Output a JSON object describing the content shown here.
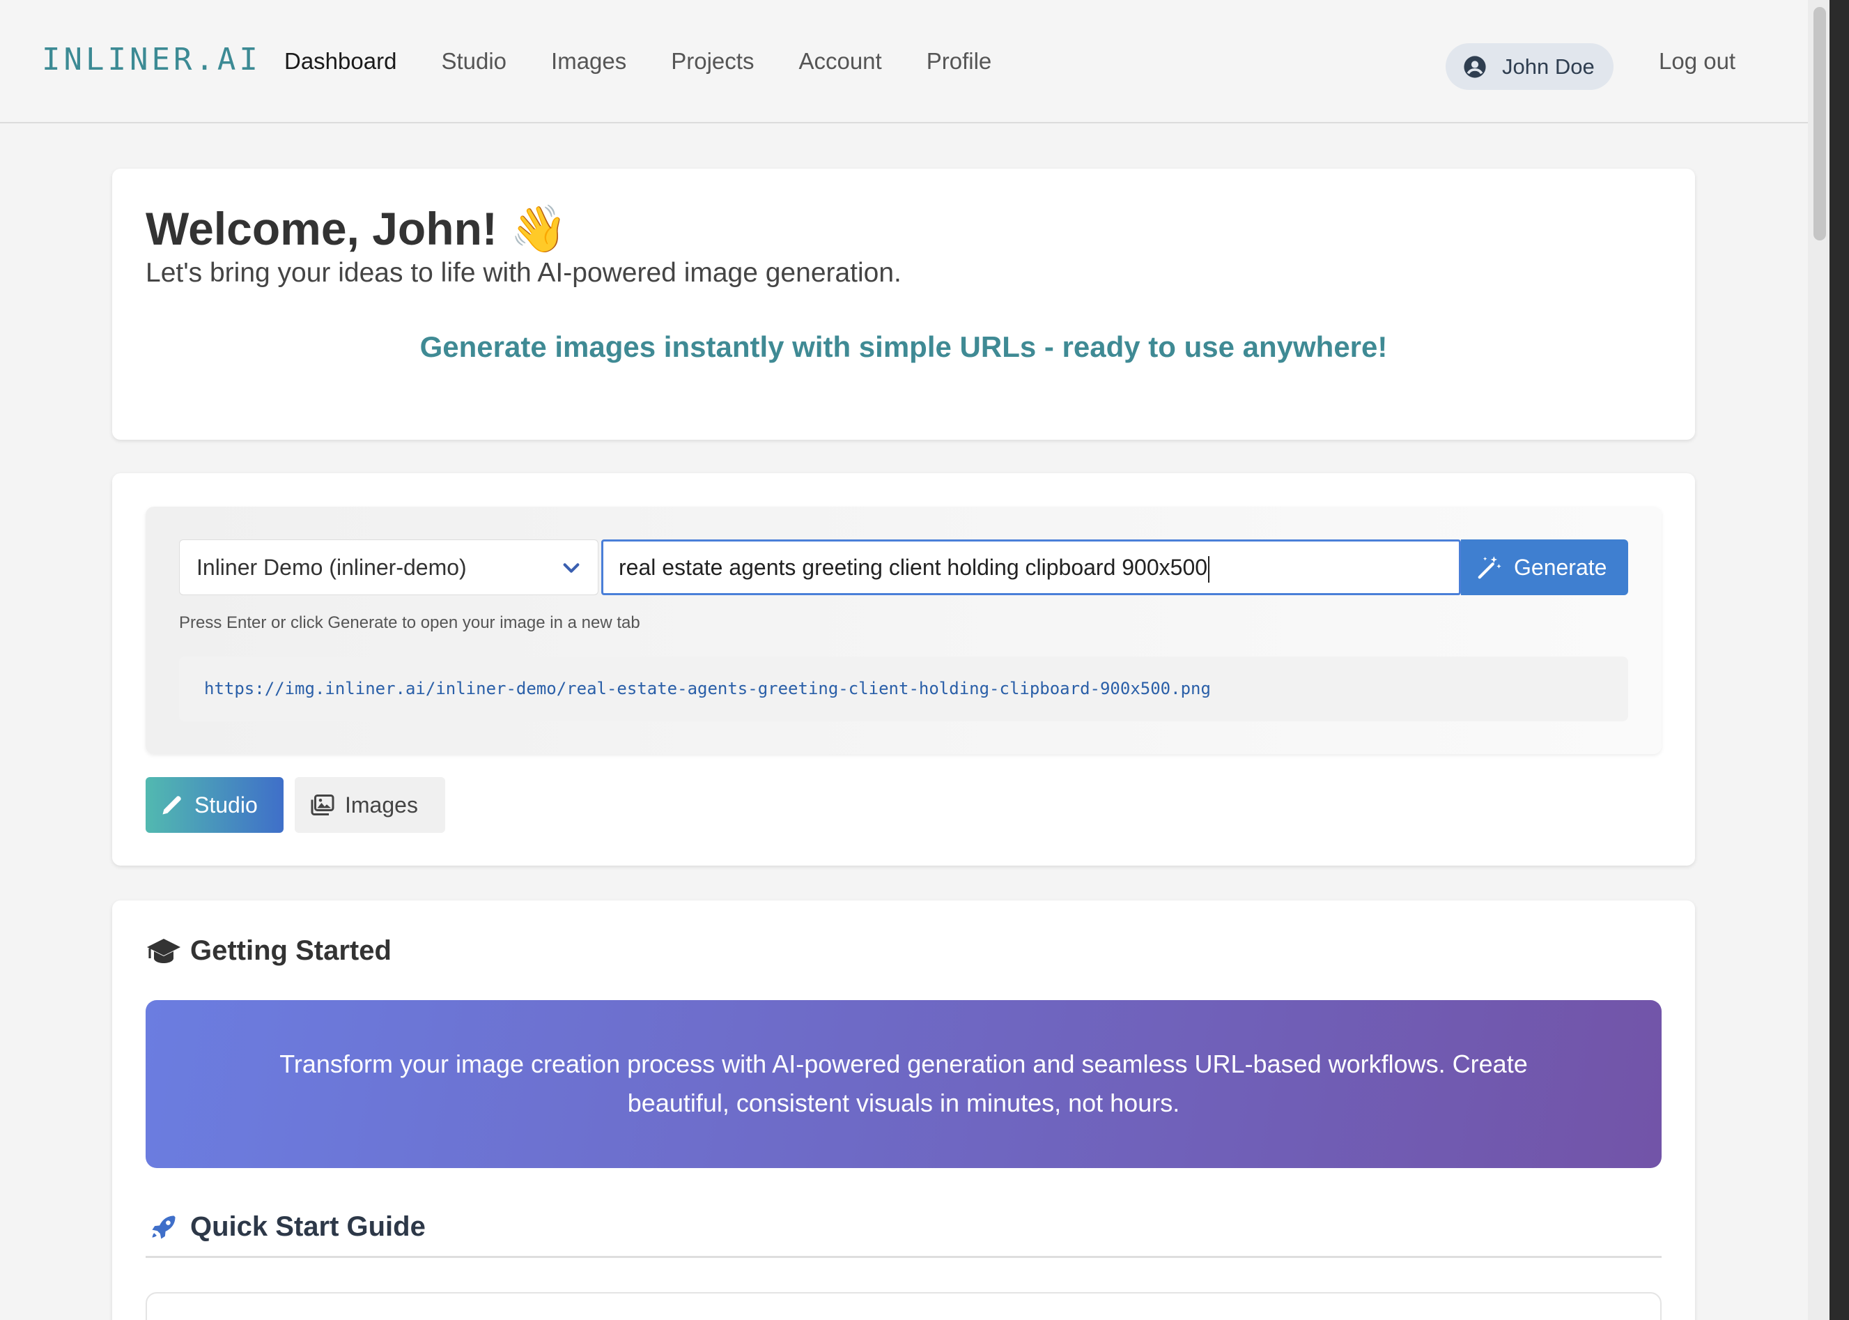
{
  "nav": {
    "brand": "INLINER.AI",
    "links": [
      "Dashboard",
      "Studio",
      "Images",
      "Projects",
      "Account",
      "Profile"
    ],
    "active": "Dashboard",
    "user_name": "John Doe",
    "logout": "Log out"
  },
  "welcome": {
    "title": "Welcome, John! 👋",
    "subtitle": "Let's bring your ideas to life with AI-powered image generation.",
    "tagline": "Generate images instantly with simple URLs - ready to use anywhere!"
  },
  "generator": {
    "project_selected": "Inliner Demo (inliner-demo)",
    "prompt_value": "real estate agents greeting client holding clipboard 900x500",
    "generate_label": "Generate",
    "hint": "Press Enter or click Generate to open your image in a new tab",
    "url": "https://img.inliner.ai/inliner-demo/real-estate-agents-greeting-client-holding-clipboard-900x500.png"
  },
  "tabs": {
    "studio": "Studio",
    "images": "Images"
  },
  "getting_started": {
    "title": "Getting Started",
    "banner": "Transform your image creation process with AI-powered generation and seamless URL-based workflows. Create beautiful, consistent visuals in minutes, not hours.",
    "quick_start_title": "Quick Start Guide"
  },
  "colors": {
    "brand": "#3c8a94",
    "accent_blue": "#3f7fd0",
    "tagline": "#3f8a94",
    "banner_start": "#6b7de0",
    "banner_end": "#7254a8"
  }
}
